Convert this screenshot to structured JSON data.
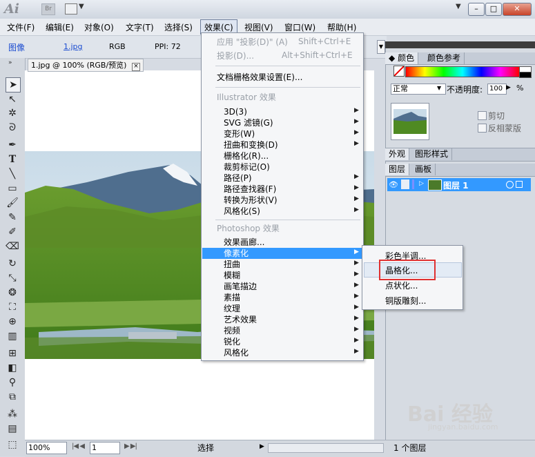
{
  "titlebar": {
    "app_logo": "Ai",
    "bridge": "Br"
  },
  "menubar": [
    "文件(F)",
    "编辑(E)",
    "对象(O)",
    "文字(T)",
    "选择(S)",
    "效果(C)",
    "视图(V)",
    "窗口(W)",
    "帮助(H)"
  ],
  "control": {
    "type": "图像",
    "file": "1.jpg",
    "mode": "RGB",
    "ppi": "PPI: 72"
  },
  "document": {
    "tab": "1.jpg @ 100% (RGB/预览)",
    "close": "×"
  },
  "status": {
    "zoom": "100%",
    "page": "1",
    "mode": "选择"
  },
  "effects_menu": {
    "apply": "应用 \"投影(D)\"  (A)",
    "apply_shortcut": "Shift+Ctrl+E",
    "shadow": "投影(D)...",
    "shadow_shortcut": "Alt+Shift+Ctrl+E",
    "raster_settings": "文档栅格效果设置(E)...",
    "illustrator_header": "Illustrator 效果",
    "illustrator_items": [
      "3D(3)",
      "SVG 滤镜(G)",
      "变形(W)",
      "扭曲和变换(D)",
      "栅格化(R)...",
      "裁剪标记(O)",
      "路径(P)",
      "路径查找器(F)",
      "转换为形状(V)",
      "风格化(S)"
    ],
    "photoshop_header": "Photoshop 效果",
    "photoshop_items": [
      "效果画廊...",
      "像素化",
      "扭曲",
      "模糊",
      "画笔描边",
      "素描",
      "纹理",
      "艺术效果",
      "视频",
      "锐化",
      "风格化"
    ]
  },
  "pixelate_submenu": [
    "彩色半调...",
    "晶格化...",
    "点状化...",
    "铜版雕刻..."
  ],
  "panels": {
    "color_tab": "颜色",
    "color_guide_tab": "颜色参考",
    "blend_mode": "正常",
    "opacity_label": "不透明度:",
    "opacity_value": "100",
    "opacity_unit": "%",
    "clip": "剪切",
    "invert_mask": "反相蒙版",
    "appearance_tab": "外观",
    "graphic_styles_tab": "图形样式",
    "layers_tab": "图层",
    "artboards_tab": "画板",
    "layer_name": "图层 1",
    "layer_count": "1 个图层"
  },
  "watermark": {
    "logo": "Bai 经验",
    "url": "jingyan.baidu.com"
  }
}
